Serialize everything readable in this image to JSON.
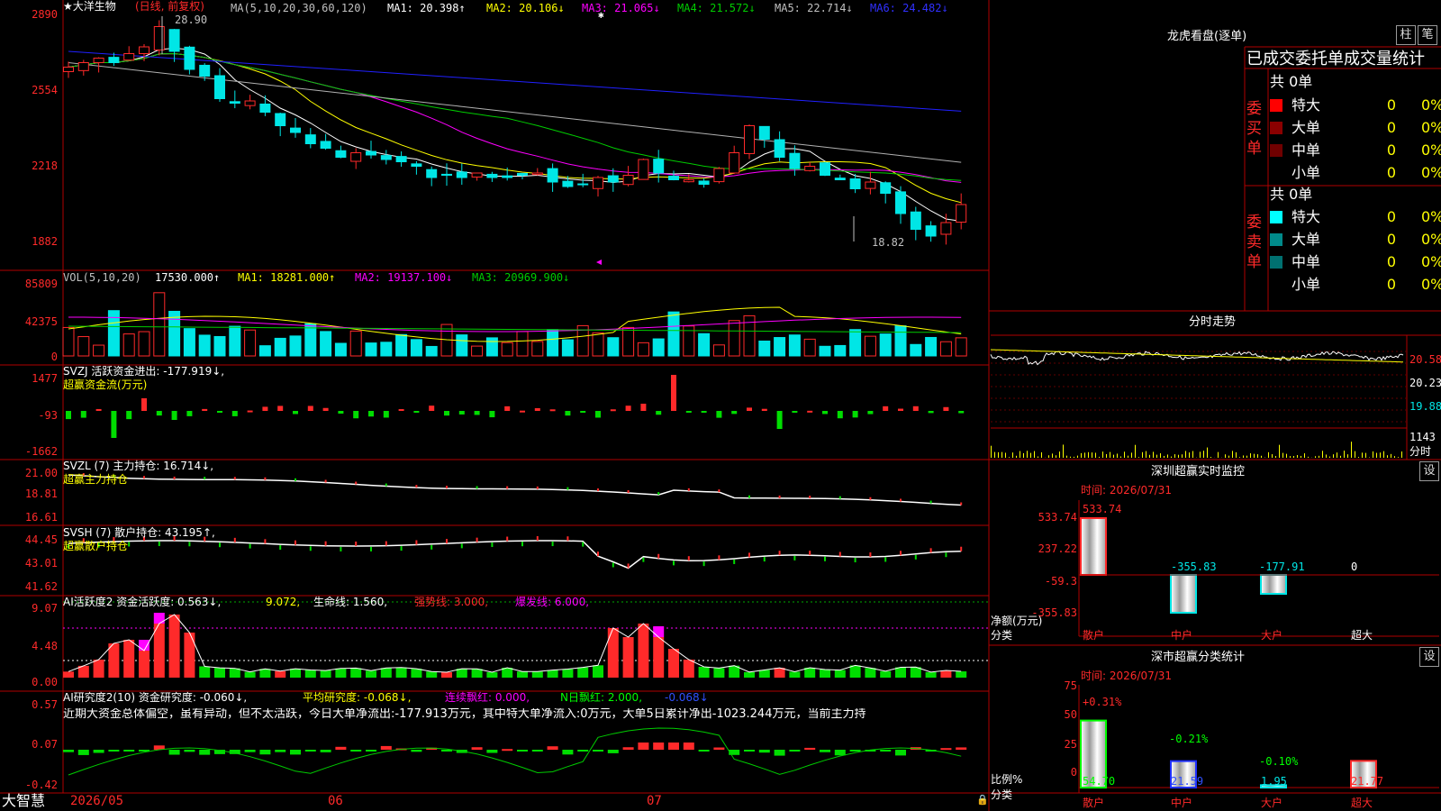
{
  "colors": {
    "up": "#ff2a2a",
    "down": "#00e6e6",
    "green": "#00dd00",
    "frame": "#b00000",
    "ma1": "#ffffff",
    "ma2": "#ffff00",
    "ma3": "#ff00ff",
    "ma4": "#00cc00",
    "ma5": "#b0b0b0",
    "ma6": "#2020ff",
    "yellow": "#ffff00",
    "magenta": "#ff00ff",
    "grey": "#c0c0c0"
  },
  "stock": {
    "name": "★大洋生物",
    "mode": "(日线, 前复权)",
    "high_label": "28.90",
    "low_label": "18.82",
    "star": "✱"
  },
  "ma_legend": {
    "params": "MA(5,10,20,30,60,120)",
    "ma1": "MA1: 20.398↑",
    "ma2": "MA2: 20.106↓",
    "ma3": "MA3: 21.065↓",
    "ma4": "MA4: 21.572↓",
    "ma5": "MA5: 22.714↓",
    "ma6": "MA6: 24.482↓"
  },
  "price_axis": [
    "2890",
    "2554",
    "2218",
    "1882"
  ],
  "vol": {
    "params": "VOL(5,10,20)",
    "value": "17530.000↑",
    "ma1": "MA1: 18281.000↑",
    "ma2": "MA2: 19137.100↓",
    "ma3": "MA3: 20969.900↓",
    "axis": [
      "85809",
      "42375",
      "0"
    ]
  },
  "svzj": {
    "line1": "SVZJ  活跃资金进出: -177.919↓,",
    "line2": "超赢资金流(万元)",
    "axis": [
      "1477",
      "-93",
      "-1662"
    ]
  },
  "svzl": {
    "line1": "SVZL (7) 主力持仓: 16.714↓,",
    "line2": "超赢主力持仓",
    "axis": [
      "21.00",
      "18.81",
      "16.61"
    ]
  },
  "svsh": {
    "line1": "SVSH (7) 散户持仓: 43.195↑,",
    "line2": "超赢散户持仓",
    "axis": [
      "44.45",
      "43.01",
      "41.62"
    ]
  },
  "ai1": {
    "a": "AI活跃度2 资金活跃度: 0.563↓,",
    "b": "9.072,",
    "c": "生命线: 1.560,",
    "d": "强势线: 3.000,",
    "e": "爆发线: 6.000,",
    "axis": [
      "9.07",
      "4.48",
      "0.00"
    ]
  },
  "ai2": {
    "a": "AI研究度2(10) 资金研究度: -0.060↓,",
    "b": "平均研究度: -0.068↓,",
    "c": "连续飘红: 0.000,",
    "d": "N日飘红: 2.000,",
    "e": "-0.068↓",
    "comment": "近期大资金总体偏空，虽有异动，但不太活跃，今日大单净流出:-177.913万元，其中特大单净流入:0万元，大单5日累计净出-1023.244万元，当前主力持",
    "axis": [
      "0.57",
      "0.07",
      "-0.42"
    ]
  },
  "bottom": {
    "brand": "大智慧",
    "date1": "2026/05",
    "date2": "06",
    "date3": "07"
  },
  "lhb": {
    "title": "龙虎看盘(逐单)",
    "btn1": "柱",
    "btn2": "笔",
    "header": "已成交委托单成交量统计",
    "buy_label": "委买单",
    "sell_label": "委卖单",
    "buy": {
      "total": "共 0单",
      "rows": [
        {
          "label": "特大",
          "count": "0",
          "pct": "0%",
          "color": "#ff0000"
        },
        {
          "label": "大单",
          "count": "0",
          "pct": "0%",
          "color": "#8b0000"
        },
        {
          "label": "中单",
          "count": "0",
          "pct": "0%",
          "color": "#700000"
        },
        {
          "label": "小单",
          "count": "0",
          "pct": "0%",
          "color": ""
        }
      ]
    },
    "sell": {
      "total": "共 0单",
      "rows": [
        {
          "label": "特大",
          "count": "0",
          "pct": "0%",
          "color": "#00ffff"
        },
        {
          "label": "大单",
          "count": "0",
          "pct": "0%",
          "color": "#008a8a"
        },
        {
          "label": "中单",
          "count": "0",
          "pct": "0%",
          "color": "#007070"
        },
        {
          "label": "小单",
          "count": "0",
          "pct": "0%",
          "color": ""
        }
      ]
    }
  },
  "intraday": {
    "title": "分时走势",
    "axis": [
      "20.58",
      "20.23",
      "19.88"
    ],
    "vol_label": "1143",
    "unit": "分时"
  },
  "sz_monitor": {
    "title": "深圳超赢实时监控",
    "btn": "设",
    "time": "时间: 2026/07/31",
    "axis": [
      "533.74",
      "237.22",
      "-59.3",
      "-355.83"
    ],
    "y_label1": "净额(万元)",
    "y_label2": "分类",
    "bars": [
      {
        "cat": "散户",
        "value": 533.74,
        "label": "533.74"
      },
      {
        "cat": "中户",
        "value": -355.83,
        "label": "-355.83"
      },
      {
        "cat": "大户",
        "value": -177.91,
        "label": "-177.91"
      },
      {
        "cat": "超大",
        "value": 0,
        "label": "0"
      }
    ]
  },
  "sz_class": {
    "title": "深市超赢分类统计",
    "btn": "设",
    "time": "时间: 2026/07/31",
    "axis": [
      "75",
      "50",
      "25",
      "0"
    ],
    "y_label1": "比例%",
    "y_label2": "分类",
    "bars": [
      {
        "cat": "散户",
        "value": 54.7,
        "label": "54.70",
        "change": "+0.31%"
      },
      {
        "cat": "中户",
        "value": 21.59,
        "label": "21.59",
        "change": "-0.21%"
      },
      {
        "cat": "大户",
        "value": 1.95,
        "label": "1.95",
        "change": "-0.10%"
      },
      {
        "cat": "超大",
        "value": 21.77,
        "label": "21.77",
        "change": ""
      }
    ]
  }
}
